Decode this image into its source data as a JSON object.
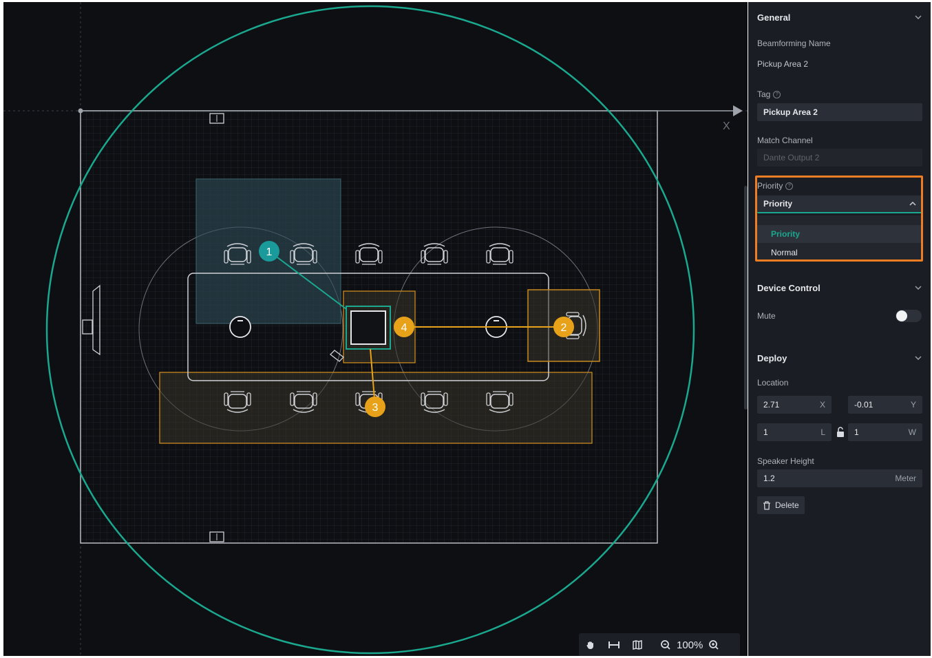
{
  "canvas": {
    "axis_label": "X",
    "pickup_markers": [
      "1",
      "2",
      "3",
      "4"
    ]
  },
  "toolbar": {
    "zoom": "100%",
    "icons": [
      "hand-icon",
      "fit-width-icon",
      "map-icon",
      "zoom-out-icon",
      "zoom-in-icon"
    ]
  },
  "panel": {
    "general": {
      "title": "General",
      "beam_name_label": "Beamforming Name",
      "beam_name_value": "Pickup Area 2",
      "tag_label": "Tag",
      "tag_value": "Pickup Area 2",
      "match_channel_label": "Match Channel",
      "match_channel_placeholder": "Dante Output 2",
      "priority_label": "Priority",
      "priority_selected": "Priority",
      "priority_options": [
        "Priority",
        "Normal"
      ]
    },
    "device_control": {
      "title": "Device Control",
      "mute_label": "Mute",
      "mute_on": false
    },
    "deploy": {
      "title": "Deploy",
      "location_label": "Location",
      "x_value": "2.71",
      "x_suffix": "X",
      "y_value": "-0.01",
      "y_suffix": "Y",
      "l_value": "1",
      "l_suffix": "L",
      "w_value": "1",
      "w_suffix": "W",
      "speaker_height_label": "Speaker Height",
      "speaker_height_value": "1.2",
      "speaker_height_unit": "Meter",
      "delete_label": "Delete"
    }
  },
  "colors": {
    "accent_teal": "#1aa88f",
    "accent_orange": "#e8a21a",
    "highlight_orange": "#ef7d22",
    "panel_bg": "#1a1d23",
    "canvas_bg": "#0d0f13"
  }
}
